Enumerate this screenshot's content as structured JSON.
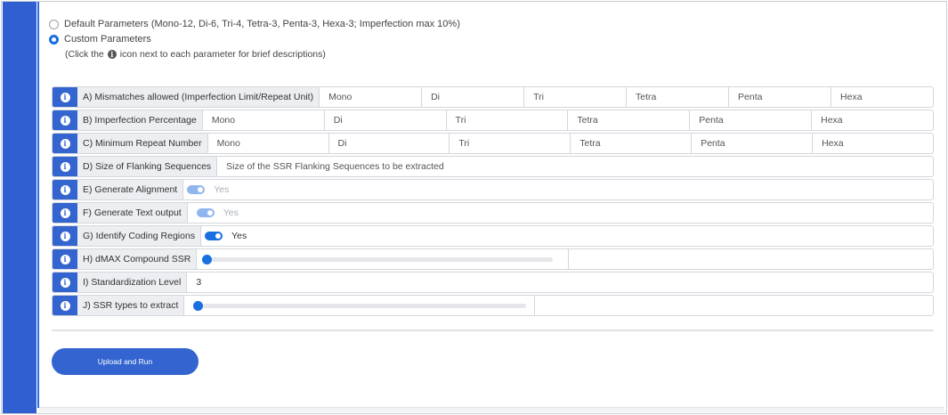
{
  "options": {
    "default_label": "Default Parameters (Mono-12, Di-6, Tri-4, Tetra-3, Penta-3, Hexa-3; Imperfection max 10%)",
    "custom_label": "Custom Parameters",
    "hint_before": "(Click the",
    "hint_after": "icon next to each parameter for brief descriptions)",
    "selected": "custom"
  },
  "params": {
    "a": {
      "label": "A) Mismatches allowed (Imperfection Limit/Repeat Unit)",
      "placeholders": [
        "Mono",
        "Di",
        "Tri",
        "Tetra",
        "Penta",
        "Hexa"
      ]
    },
    "b": {
      "label": "B) Imperfection Percentage",
      "placeholders": [
        "Mono",
        "Di",
        "Tri",
        "Tetra",
        "Penta",
        "Hexa"
      ]
    },
    "c": {
      "label": "C) Minimum Repeat Number",
      "placeholders": [
        "Mono",
        "Di",
        "Tri",
        "Tetra",
        "Penta",
        "Hexa"
      ]
    },
    "d": {
      "label": "D) Size of Flanking Sequences",
      "placeholder": "Size of the SSR Flanking Sequences to be extracted"
    },
    "e": {
      "label": "E) Generate Alignment",
      "toggle_text": "Yes",
      "enabled": false
    },
    "f": {
      "label": "F) Generate Text output",
      "toggle_text": "Yes",
      "enabled": false
    },
    "g": {
      "label": "G) Identify Coding Regions",
      "toggle_text": "Yes",
      "enabled": true
    },
    "h": {
      "label": "H) dMAX Compound SSR",
      "value": 0
    },
    "i": {
      "label": "I) Standardization Level",
      "value": "3"
    },
    "j": {
      "label": "J) SSR types to extract",
      "value": 0
    }
  },
  "info_icon_glyph": "i",
  "run_button": {
    "label": "Upload and Run"
  },
  "colors": {
    "accent": "#3364cf",
    "toggle_on": "#1a6fe0",
    "side_bar": "#2f5fd0"
  }
}
